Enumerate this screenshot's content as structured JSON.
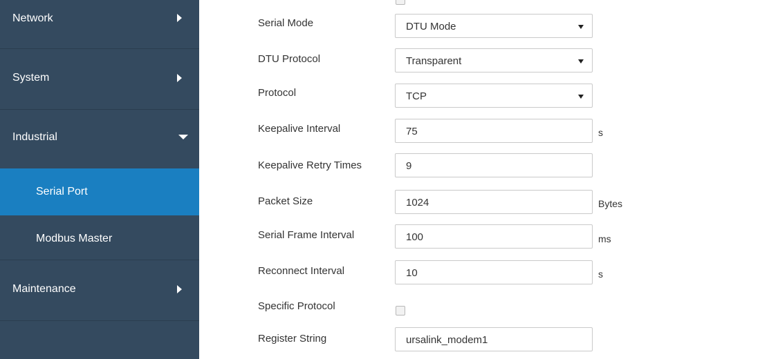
{
  "sidebar": {
    "items": [
      {
        "label": "Network"
      },
      {
        "label": "System"
      },
      {
        "label": "Industrial"
      },
      {
        "label": "Maintenance"
      }
    ],
    "sub_items": [
      {
        "label": "Serial Port",
        "active": true
      },
      {
        "label": "Modbus Master",
        "active": false
      }
    ],
    "colors": {
      "background": "#344a5f",
      "active": "#1a7fc1"
    }
  },
  "form": {
    "serial_mode": {
      "label": "Serial Mode",
      "value": "DTU Mode"
    },
    "dtu_protocol": {
      "label": "DTU Protocol",
      "value": "Transparent"
    },
    "protocol": {
      "label": "Protocol",
      "value": "TCP"
    },
    "keepalive_interval": {
      "label": "Keepalive Interval",
      "value": "75",
      "unit": "s"
    },
    "keepalive_retry_times": {
      "label": "Keepalive Retry Times",
      "value": "9"
    },
    "packet_size": {
      "label": "Packet Size",
      "value": "1024",
      "unit": "Bytes"
    },
    "serial_frame_interval": {
      "label": "Serial Frame Interval",
      "value": "100",
      "unit": "ms"
    },
    "reconnect_interval": {
      "label": "Reconnect Interval",
      "value": "10",
      "unit": "s"
    },
    "specific_protocol": {
      "label": "Specific Protocol",
      "checked": false
    },
    "register_string": {
      "label": "Register String",
      "value": "ursalink_modem1"
    }
  }
}
